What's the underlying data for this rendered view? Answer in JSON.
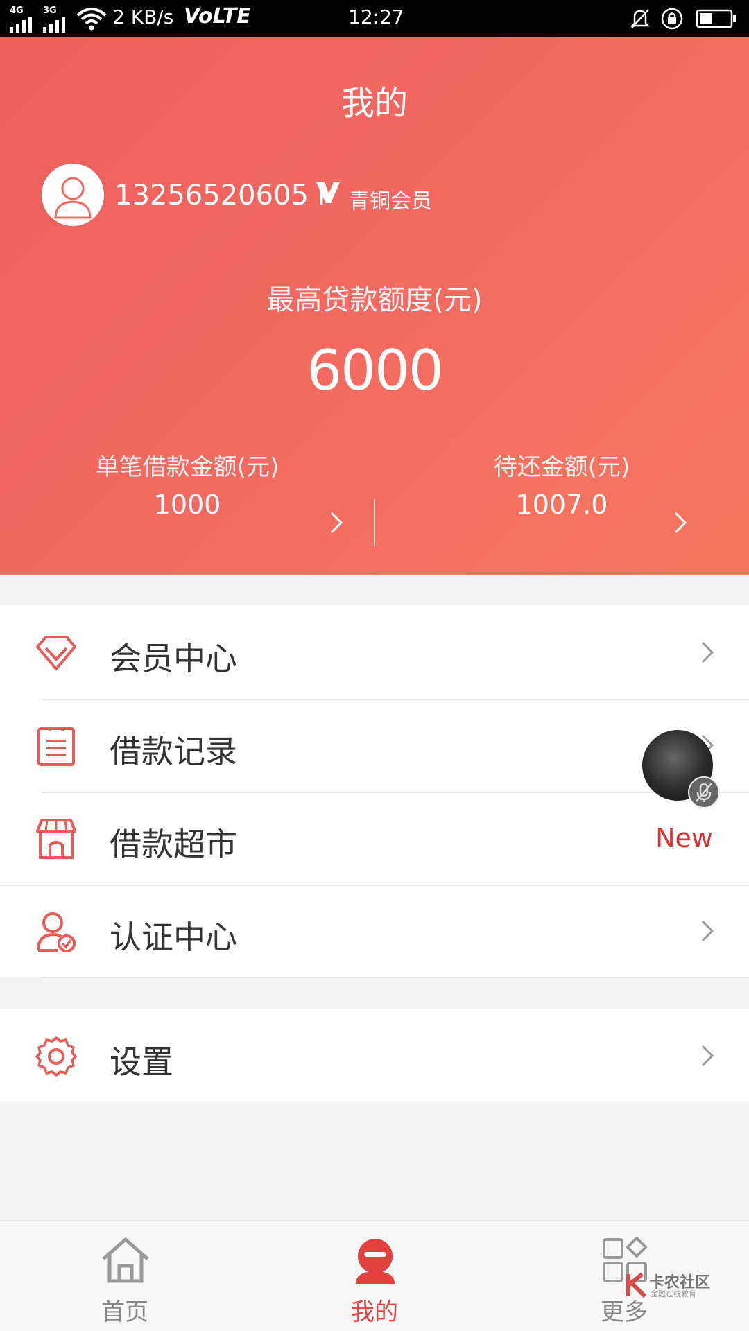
{
  "status_bar": {
    "network_4g": "4G",
    "network_3g": "3G",
    "speed": "2 KB/s",
    "volte": "VoLTE",
    "time": "12:27"
  },
  "header": {
    "title": "我的",
    "phone": "13256520605 I",
    "member_level": "青铜会员",
    "credit_label": "最高贷款额度(元)",
    "credit_value": "6000",
    "single_loan": {
      "label": "单笔借款金额(元)",
      "value": "1000"
    },
    "pending_repay": {
      "label": "待还金额(元)",
      "value": "1007.0"
    }
  },
  "menu": {
    "group1": [
      {
        "label": "会员中心",
        "icon": "diamond-icon"
      },
      {
        "label": "借款记录",
        "icon": "document-icon"
      },
      {
        "label": "借款超市",
        "icon": "store-icon",
        "badge": "New"
      },
      {
        "label": "认证中心",
        "icon": "user-verified-icon"
      }
    ],
    "group2": [
      {
        "label": "设置",
        "icon": "gear-icon"
      }
    ]
  },
  "bottom_nav": {
    "items": [
      {
        "label": "首页",
        "icon": "home-icon"
      },
      {
        "label": "我的",
        "icon": "profile-icon",
        "active": true
      },
      {
        "label": "更多",
        "icon": "grid-icon"
      }
    ]
  },
  "watermark": {
    "title": "卡农社区",
    "subtitle": "金融在线教育"
  },
  "colors": {
    "accent": "#f06a60",
    "active_nav": "#e3413f",
    "badge_new": "#d8302f"
  }
}
